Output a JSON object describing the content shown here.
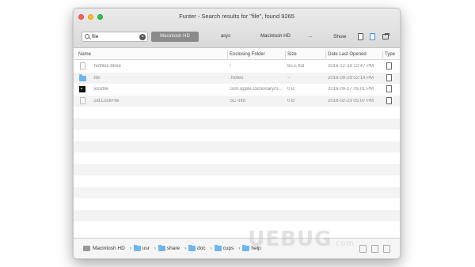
{
  "window": {
    "title": "Funter - Search results for \"file\", found 9265"
  },
  "toolbar": {
    "search_value": "file",
    "scopes": [
      "Macintosh HD",
      "asys",
      "Macintosh HD",
      "..."
    ],
    "show_label": "Show"
  },
  "table": {
    "columns": [
      "Name",
      "Enclosing Folder",
      "Size",
      "Date Last Opened",
      "Type"
    ],
    "rows": [
      {
        "name": ".hotfiles.btree",
        "folder": "/",
        "size": "65.5 KB",
        "date": "2016-12-28 12:47 PM",
        "icon": "doc-icon"
      },
      {
        "name": ".file",
        "folder": ".Notes",
        "size": "--",
        "date": "2016-09-29 02:14 PM",
        "icon": "folder-icon"
      },
      {
        "name": ".lockfile",
        "folder": "com.apple.Dictionary/S...",
        "size": "0 B",
        "date": "2016-09-27 05:01 PM",
        "icon": "exec-icon"
      },
      {
        "name": ".sid.LockFile",
        "folder": "SC Info",
        "size": "0 B",
        "date": "2016-02-23 05:07 PM",
        "icon": "doc-icon"
      }
    ]
  },
  "pathbar": {
    "crumbs": [
      "Macintosh HD",
      "usr",
      "share",
      "doc",
      "cups",
      "help"
    ]
  },
  "watermark": {
    "text": "UEBUG",
    "suffix": ".com"
  },
  "colors": {
    "folder": "#6fb5ee",
    "scope_active": "#8b8b8b",
    "close": "#fc5f57",
    "minimize": "#fdbc2e",
    "zoom": "#28c840"
  }
}
